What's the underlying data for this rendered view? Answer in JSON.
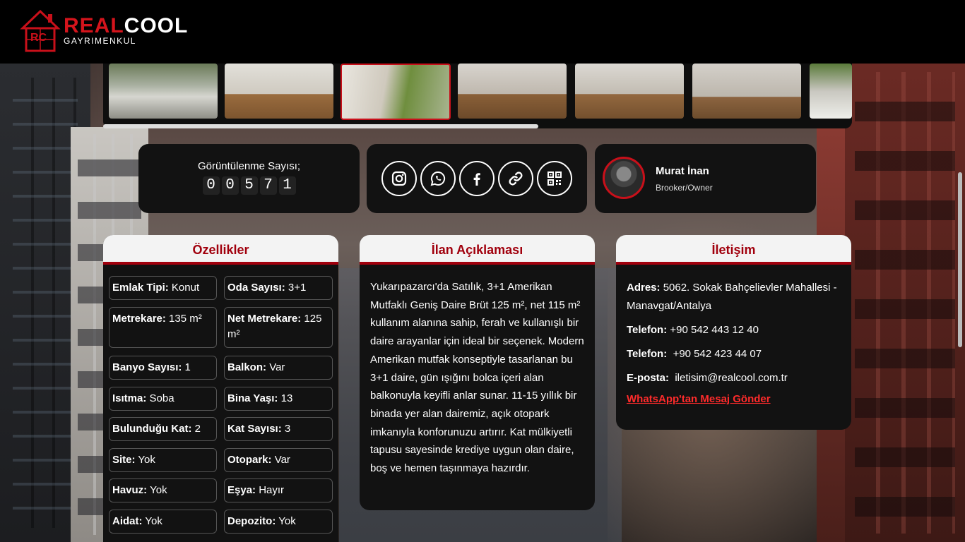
{
  "header": {
    "logo_primary": "REAL",
    "logo_secondary": "COOL",
    "logo_sub": "GAYRIMENKUL",
    "logo_mark_text": "RC"
  },
  "colors": {
    "accent": "#a1000d",
    "brand_red": "#d4141c",
    "card_bg": "#121212"
  },
  "gallery": {
    "thumbnails": [
      "building-exterior",
      "empty-room",
      "balcony",
      "empty-room",
      "empty-room",
      "empty-room",
      "building-exterior"
    ],
    "active_index": 2
  },
  "views": {
    "title": "Görüntülenme Sayısı;",
    "digits": [
      "0",
      "0",
      "5",
      "7",
      "1"
    ]
  },
  "social": [
    "instagram-icon",
    "whatsapp-icon",
    "facebook-icon",
    "link-icon",
    "qr-code-icon"
  ],
  "agent": {
    "name": "Murat İnan",
    "role": "Brooker/Owner"
  },
  "features": {
    "title": "Özellikler",
    "items": [
      {
        "label": "Emlak Tipi:",
        "value": "Konut"
      },
      {
        "label": "Oda Sayısı:",
        "value": "3+1"
      },
      {
        "label": "Metrekare:",
        "value": "135 m²"
      },
      {
        "label": "Net Metrekare:",
        "value": "125 m²"
      },
      {
        "label": "Banyo Sayısı:",
        "value": "1"
      },
      {
        "label": "Balkon:",
        "value": "Var"
      },
      {
        "label": "Isıtma:",
        "value": "Soba"
      },
      {
        "label": "Bina Yaşı:",
        "value": "13"
      },
      {
        "label": "Bulunduğu Kat:",
        "value": "2"
      },
      {
        "label": "Kat Sayısı:",
        "value": "3"
      },
      {
        "label": "Site:",
        "value": "Yok"
      },
      {
        "label": "Otopark:",
        "value": "Var"
      },
      {
        "label": "Havuz:",
        "value": "Yok"
      },
      {
        "label": "Eşya:",
        "value": "Hayır"
      },
      {
        "label": "Aidat:",
        "value": "Yok"
      },
      {
        "label": "Depozito:",
        "value": "Yok"
      }
    ]
  },
  "description": {
    "title": "İlan Açıklaması",
    "text": "Yukarıpazarcı'da Satılık, 3+1 Amerikan Mutfaklı Geniş Daire Brüt 125 m², net 115 m² kullanım alanına sahip, ferah ve kullanışlı bir daire arayanlar için ideal bir seçenek. Modern Amerikan mutfak konseptiyle tasarlanan bu 3+1 daire, gün ışığını bolca içeri alan balkonuyla keyifli anlar sunar. 11-15 yıllık bir binada yer alan dairemiz, açık otopark imkanıyla konforunuzu artırır. Kat mülkiyetli tapusu sayesinde krediye uygun olan daire, boş ve hemen taşınmaya hazırdır."
  },
  "contact": {
    "title": "İletişim",
    "address_label": "Adres:",
    "address": "5062. Sokak Bahçelievler Mahallesi - Manavgat/Antalya",
    "phone1_label": "Telefon:",
    "phone1": "+90 542 443 12 40",
    "phone2_label": "Telefon:",
    "phone2": "+90 542 423 44 07",
    "email_label": "E-posta:",
    "email": "iletisim@realcool.com.tr",
    "whatsapp_link": "WhatsApp'tan Mesaj Gönder"
  }
}
